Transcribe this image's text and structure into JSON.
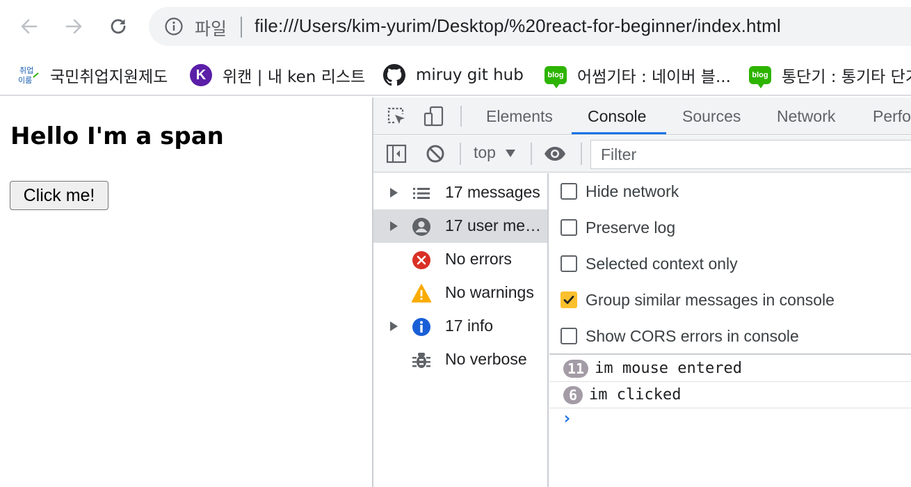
{
  "toolbar": {
    "back_icon": "arrow-left-icon",
    "forward_icon": "arrow-right-icon",
    "reload_icon": "reload-icon",
    "scheme_label": "파일",
    "url": "file:///Users/kim-yurim/Desktop/%20react-for-beginner/index.html"
  },
  "bookmarks": [
    {
      "label": "국민취업지원제도",
      "icon": "employment-logo-icon"
    },
    {
      "label": "위캔 | 내 ken 리스트",
      "icon": "k-logo-icon"
    },
    {
      "label": "miruy git hub",
      "icon": "github-icon"
    },
    {
      "label": "어썸기타 : 네이버 블...",
      "icon": "naver-blog-icon",
      "badge": "blog"
    },
    {
      "label": "통단기 : 통기타 단기",
      "icon": "naver-blog-icon",
      "badge": "blog"
    }
  ],
  "page": {
    "heading": "Hello I'm a span",
    "button_label": "Click me!"
  },
  "devtools": {
    "tabs": [
      "Elements",
      "Console",
      "Sources",
      "Network",
      "Perfo"
    ],
    "active_tab": "Console",
    "context": "top",
    "filter_placeholder": "Filter",
    "sidebar": [
      {
        "label": "17 messages",
        "icon": "list-icon",
        "expandable": true,
        "selected": false
      },
      {
        "label": "17 user me…",
        "icon": "user-icon",
        "expandable": true,
        "selected": true
      },
      {
        "label": "No errors",
        "icon": "error-icon",
        "expandable": false,
        "selected": false
      },
      {
        "label": "No warnings",
        "icon": "warning-icon",
        "expandable": false,
        "selected": false
      },
      {
        "label": "17 info",
        "icon": "info-icon",
        "expandable": true,
        "selected": false
      },
      {
        "label": "No verbose",
        "icon": "bug-icon",
        "expandable": false,
        "selected": false
      }
    ],
    "settings": [
      {
        "label": "Hide network",
        "checked": false
      },
      {
        "label": "Preserve log",
        "checked": false
      },
      {
        "label": "Selected context only",
        "checked": false
      },
      {
        "label": "Group similar messages in console",
        "checked": true
      },
      {
        "label": "Show CORS errors in console",
        "checked": false
      }
    ],
    "logs": [
      {
        "count": "11",
        "text": "im mouse entered"
      },
      {
        "count": "6",
        "text": "im clicked"
      }
    ],
    "prompt_symbol": "›"
  },
  "colors": {
    "accent": "#1a73e8",
    "checkbox_checked": "#fbc02d",
    "error": "#d93025",
    "warning": "#f9ab00",
    "info": "#1a73e8",
    "badge": "#a39ca6"
  }
}
